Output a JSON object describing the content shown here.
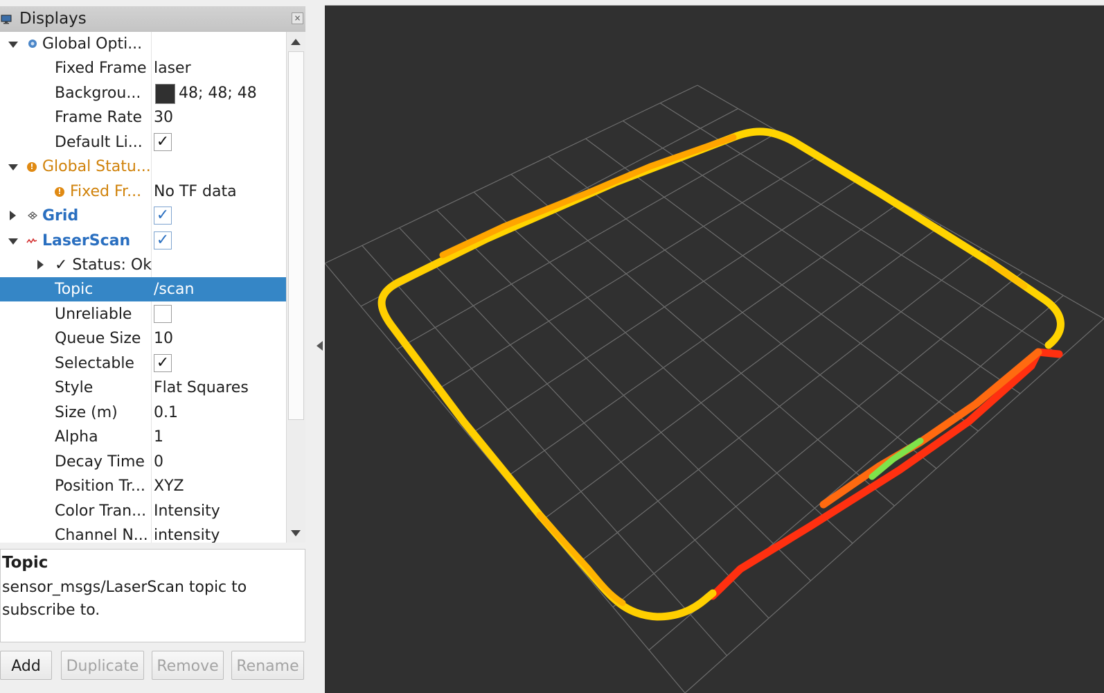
{
  "panel": {
    "title": "Displays"
  },
  "tree": {
    "global_options": "Global Opti...",
    "fixed_frame_label": "Fixed Frame",
    "fixed_frame_value": "laser",
    "background_label": "Backgrou...",
    "background_value": "48; 48; 48",
    "frame_rate_label": "Frame Rate",
    "frame_rate_value": "30",
    "default_light_label": "Default Li...",
    "global_status": "Global Statu...",
    "fixed_frame_status_label": "Fixed Fr...",
    "fixed_frame_status_value": "No TF data",
    "grid_label": "Grid",
    "laserscan_label": "LaserScan",
    "status_label": "✓ Status: Ok",
    "topic_label": "Topic",
    "topic_value": "/scan",
    "unreliable_label": "Unreliable",
    "queue_size_label": "Queue Size",
    "queue_size_value": "10",
    "selectable_label": "Selectable",
    "style_label": "Style",
    "style_value": "Flat Squares",
    "size_label": "Size (m)",
    "size_value": "0.1",
    "alpha_label": "Alpha",
    "alpha_value": "1",
    "decay_label": "Decay Time",
    "decay_value": "0",
    "position_label": "Position Tr...",
    "position_value": "XYZ",
    "color_label": "Color Tran...",
    "color_value": "Intensity",
    "channel_label": "Channel N...",
    "channel_value": "intensity"
  },
  "checks": {
    "default_light": true,
    "grid": true,
    "laserscan": true,
    "unreliable": false,
    "selectable": true
  },
  "description": {
    "title": "Topic",
    "text": "sensor_msgs/LaserScan topic to subscribe to."
  },
  "buttons": {
    "add": "Add",
    "duplicate": "Duplicate",
    "remove": "Remove",
    "rename": "Rename"
  },
  "colors": {
    "background": "#303030",
    "selection": "#3586c6",
    "warning": "#d0820a",
    "link_blue": "#2a6fc0",
    "scan_yellow": "#ffe600",
    "scan_orange": "#ff9a00",
    "scan_red": "#ff2a00"
  }
}
